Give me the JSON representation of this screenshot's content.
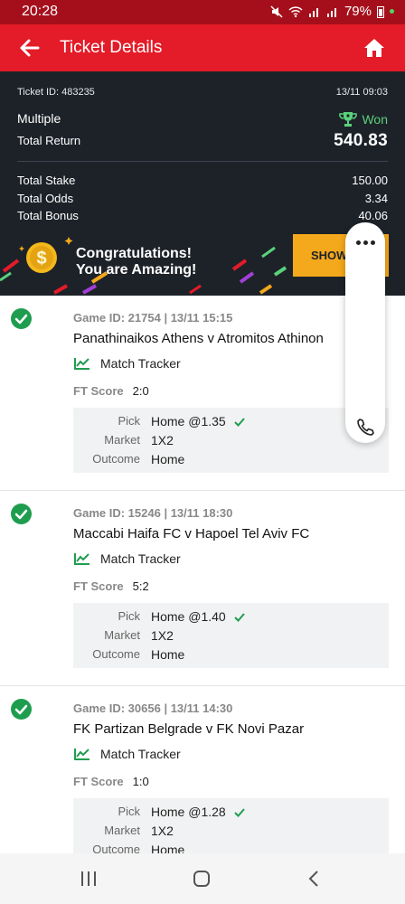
{
  "status_bar": {
    "time": "20:28",
    "battery": "79%"
  },
  "header": {
    "title": "Ticket Details"
  },
  "summary": {
    "ticket_id": "Ticket ID: 483235",
    "date": "13/11 09:03",
    "bet_type": "Multiple",
    "status": "Won",
    "total_return_label": "Total Return",
    "total_return": "540.83",
    "rows": [
      {
        "label": "Total Stake",
        "value": "150.00"
      },
      {
        "label": "Total Odds",
        "value": "3.34"
      },
      {
        "label": "Total Bonus",
        "value": "40.06"
      }
    ]
  },
  "banner": {
    "line1": "Congratulations!",
    "line2": "You are Amazing!",
    "button": "SHOW"
  },
  "games": [
    {
      "meta": "Game ID: 21754 | 13/11 15:15",
      "teams": "Panathinaikos Athens v Atromitos Athinon",
      "tracker": "Match Tracker",
      "ft_label": "FT Score",
      "ft_score": "2:0",
      "pick_label": "Pick",
      "pick": "Home @1.35",
      "market_label": "Market",
      "market": "1X2",
      "outcome_label": "Outcome",
      "outcome": "Home"
    },
    {
      "meta": "Game ID: 15246 | 13/11 18:30",
      "teams": "Maccabi Haifa FC v Hapoel Tel Aviv FC",
      "tracker": "Match Tracker",
      "ft_label": "FT Score",
      "ft_score": "5:2",
      "pick_label": "Pick",
      "pick": "Home @1.40",
      "market_label": "Market",
      "market": "1X2",
      "outcome_label": "Outcome",
      "outcome": "Home"
    },
    {
      "meta": "Game ID: 30656 | 13/11 14:30",
      "teams": "FK Partizan Belgrade v FK Novi Pazar",
      "tracker": "Match Tracker",
      "ft_label": "FT Score",
      "ft_score": "1:0",
      "pick_label": "Pick",
      "pick": "Home @1.28",
      "market_label": "Market",
      "market": "1X2",
      "outcome_label": "Outcome",
      "outcome": "Home"
    }
  ],
  "colors": {
    "header_red": "#e41b28",
    "status_red": "#a50f1c",
    "summary_bg": "#1d2229",
    "won_green": "#5ad17b",
    "check_green": "#1f9d4f",
    "button_orange": "#f4a81b"
  },
  "icons": {
    "back": "arrow-left-icon",
    "home": "home-icon",
    "trophy": "trophy-icon",
    "coin": "dollar-coin-icon",
    "more": "more-dots-icon",
    "phone": "phone-icon",
    "check": "check-circle-icon",
    "tracker": "chart-line-icon"
  }
}
